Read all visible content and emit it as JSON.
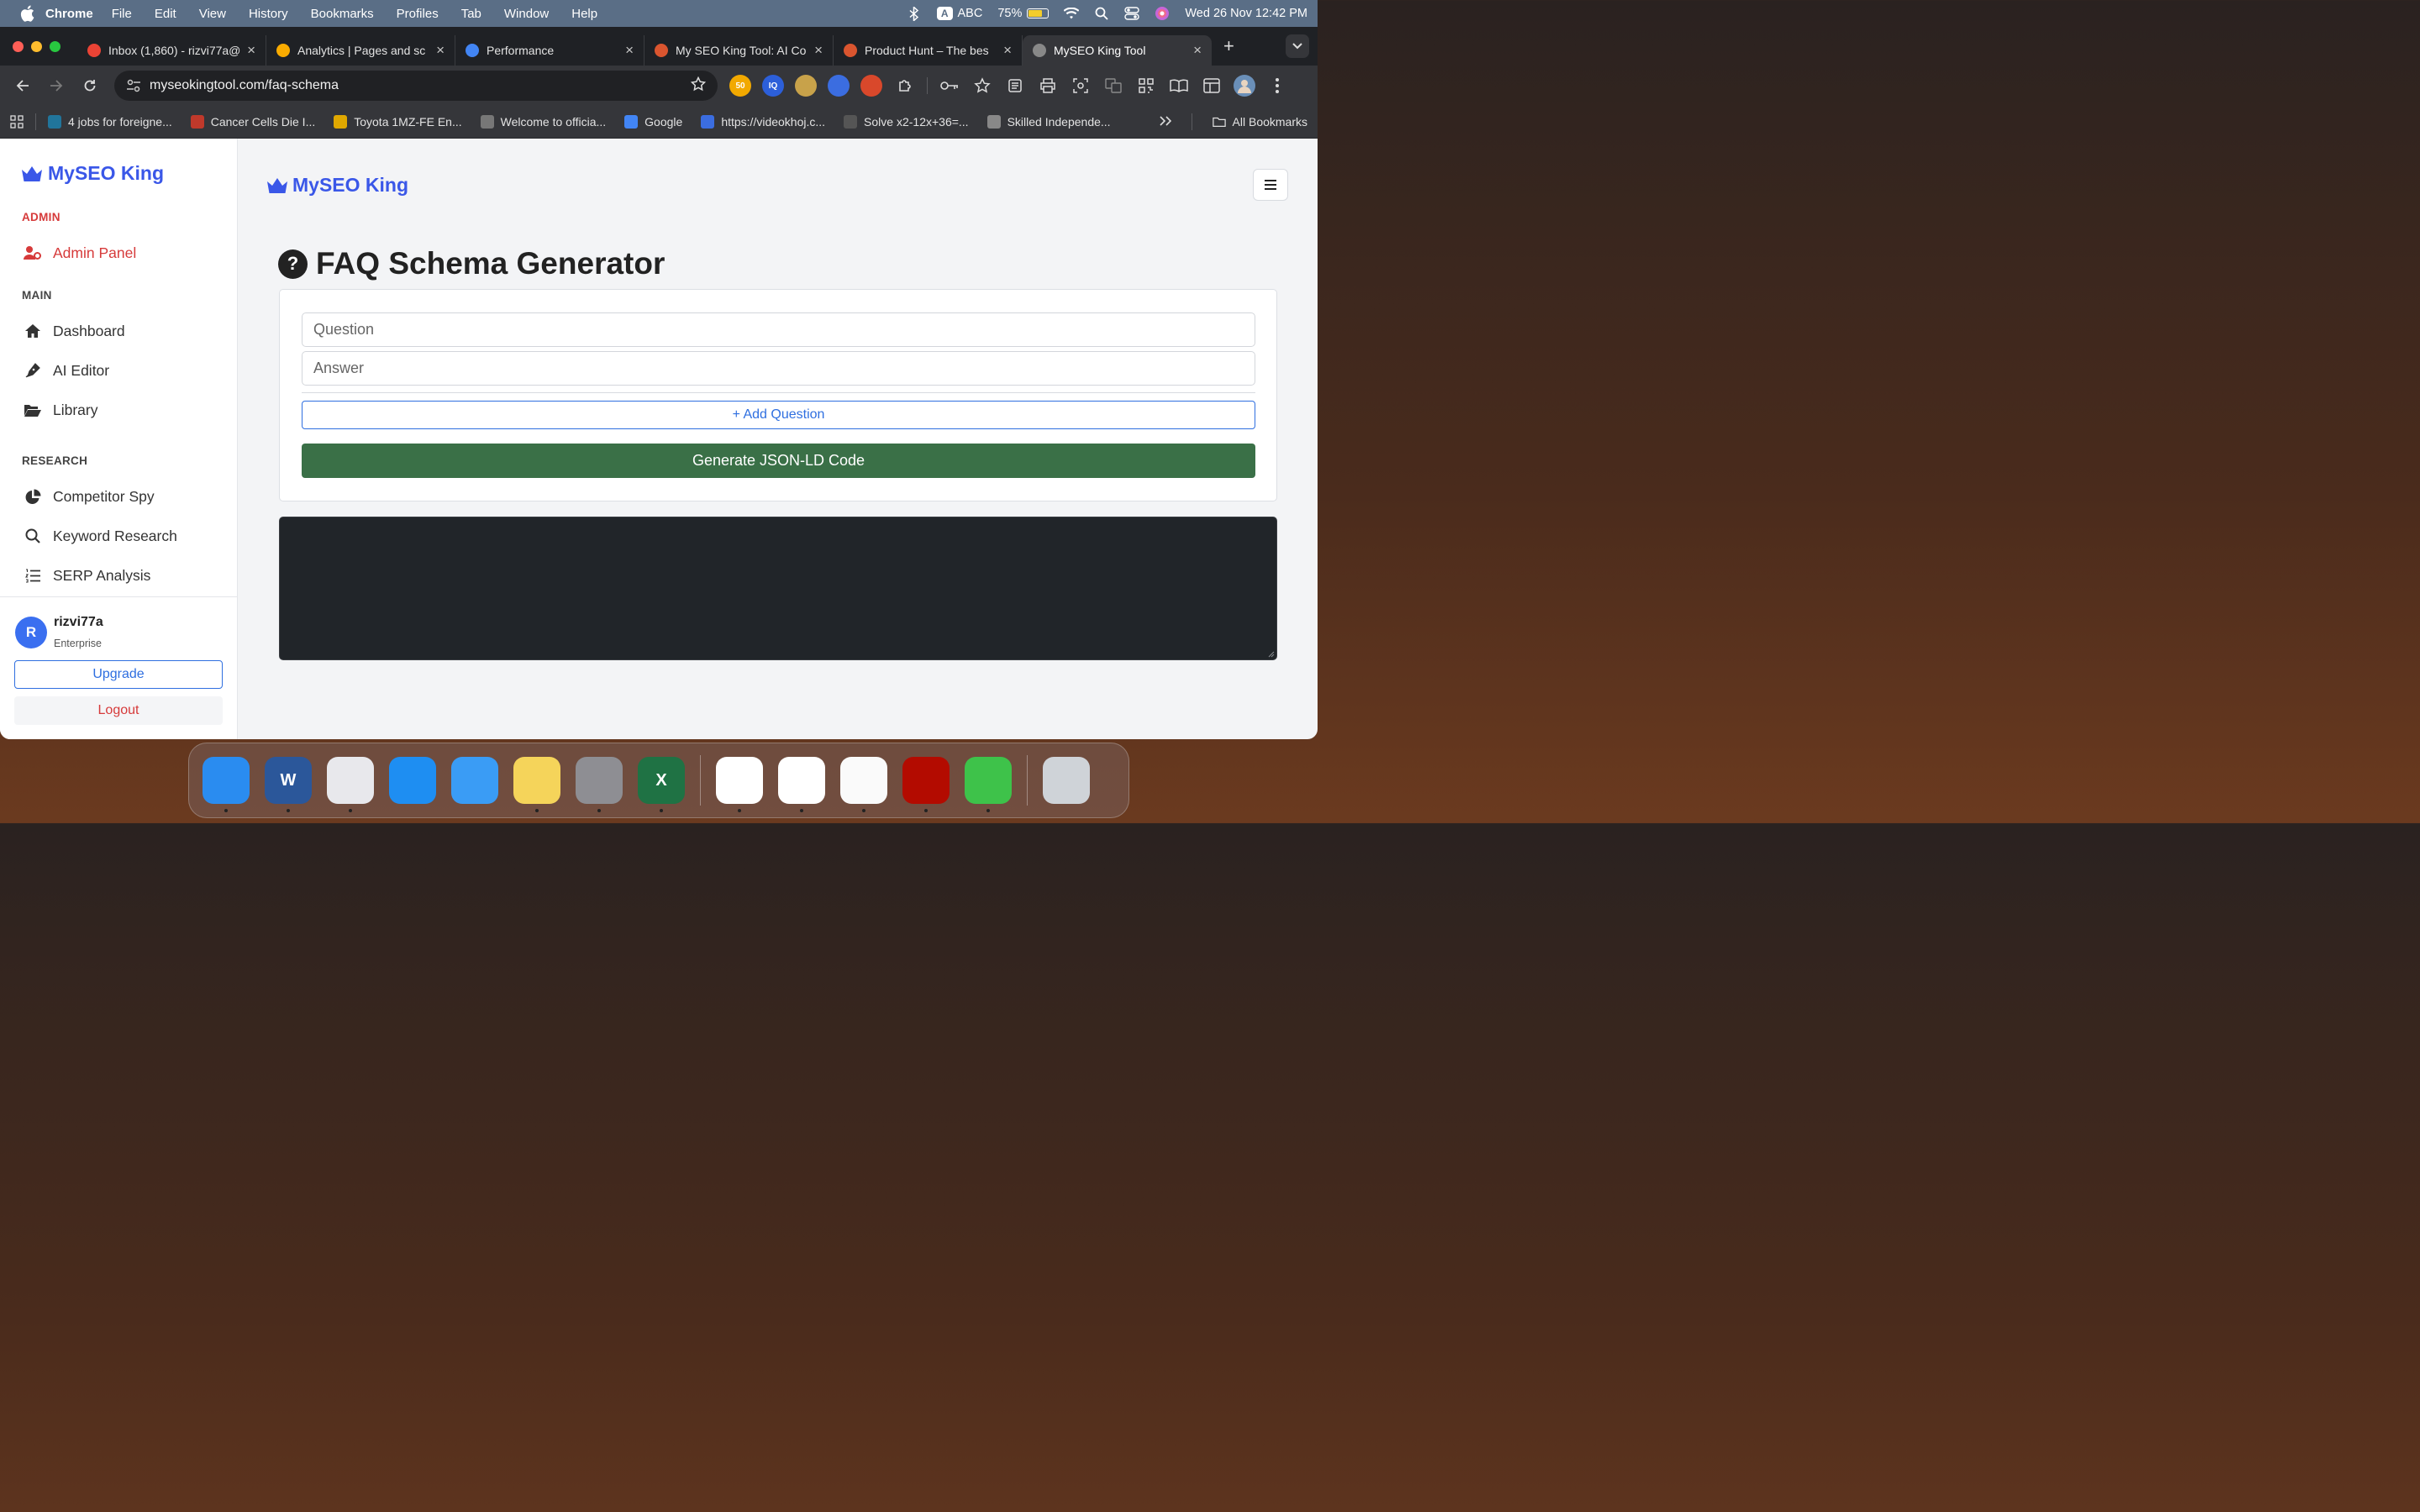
{
  "menubar": {
    "app": "Chrome",
    "items": [
      "File",
      "Edit",
      "View",
      "History",
      "Bookmarks",
      "Profiles",
      "Tab",
      "Window",
      "Help"
    ],
    "input_source": "A",
    "input_label": "ABC",
    "battery": "75%",
    "battery_level": 0.75,
    "datetime": "Wed 26 Nov  12:42 PM"
  },
  "tabs": [
    {
      "title": "Inbox (1,860) - rizvi77a@",
      "icon": "gmail-icon",
      "color": "#ea4335"
    },
    {
      "title": "Analytics | Pages and sc",
      "icon": "analytics-icon",
      "color": "#f9ab00"
    },
    {
      "title": "Performance",
      "icon": "search-console-icon",
      "color": "#4285f4"
    },
    {
      "title": "My SEO King Tool: AI Co",
      "icon": "product-hunt-icon",
      "color": "#da552f"
    },
    {
      "title": "Product Hunt – The bes",
      "icon": "product-hunt-icon",
      "color": "#da552f"
    },
    {
      "title": "MySEO King Tool",
      "icon": "globe-icon",
      "color": "#888888"
    }
  ],
  "address_bar": {
    "url": "myseokingtool.com/faq-schema"
  },
  "extensions": [
    {
      "label": "50",
      "color": "#f2a900"
    },
    {
      "label": "IQ",
      "color": "#2c5fd9"
    },
    {
      "label": "",
      "color": "#c8a24a"
    },
    {
      "label": "",
      "color": "#3b6de0"
    },
    {
      "label": "",
      "color": "#d9482b"
    }
  ],
  "bookmarks": [
    {
      "label": "4 jobs for foreigne...",
      "icon": "wordpress-icon",
      "color": "#21759b"
    },
    {
      "label": "Cancer Cells Die I...",
      "icon": "news-icon",
      "color": "#c0392b"
    },
    {
      "label": "Toyota 1MZ-FE En...",
      "icon": "engine-icon",
      "color": "#e0a800"
    },
    {
      "label": "Welcome to officia...",
      "icon": "seal-icon",
      "color": "#777777"
    },
    {
      "label": "Google",
      "icon": "google-icon",
      "color": "#4285f4"
    },
    {
      "label": "https://videokhoj.c...",
      "icon": "check-icon",
      "color": "#3b6de0"
    },
    {
      "label": "Solve x2-12x+36=...",
      "icon": "math-icon",
      "color": "#555555"
    },
    {
      "label": "Skilled Independe...",
      "icon": "globe-icon",
      "color": "#888888"
    }
  ],
  "all_bookmarks": "All Bookmarks",
  "brand": {
    "name": "MySEO King",
    "color": "#3a57e8"
  },
  "sidebar": {
    "sections": {
      "admin": "ADMIN",
      "main": "MAIN",
      "research": "RESEARCH"
    },
    "items": {
      "admin_panel": "Admin Panel",
      "dashboard": "Dashboard",
      "ai_editor": "AI Editor",
      "library": "Library",
      "competitor_spy": "Competitor Spy",
      "keyword_research": "Keyword Research",
      "serp_analysis": "SERP Analysis"
    },
    "user": {
      "initial": "R",
      "name": "rizvi77a",
      "plan": "Enterprise",
      "upgrade": "Upgrade",
      "logout": "Logout"
    }
  },
  "main": {
    "title": "FAQ Schema Generator",
    "question_placeholder": "Question",
    "answer_placeholder": "Answer",
    "add_question": "+ Add Question",
    "generate": "Generate JSON-LD Code"
  },
  "dock": [
    {
      "name": "finder-icon",
      "label": "",
      "color": "#2a8cf0"
    },
    {
      "name": "word-icon",
      "label": "W",
      "color": "#2b579a"
    },
    {
      "name": "launchpad-icon",
      "label": "",
      "color": "#e8e8ec"
    },
    {
      "name": "safari-icon",
      "label": "",
      "color": "#1e8ef2"
    },
    {
      "name": "mail-icon",
      "label": "",
      "color": "#3a9cf5"
    },
    {
      "name": "notes-icon",
      "label": "",
      "color": "#f5d45a"
    },
    {
      "name": "settings-icon",
      "label": "",
      "color": "#8e8e93"
    },
    {
      "name": "excel-icon",
      "label": "X",
      "color": "#1f7244"
    },
    {
      "name": "chrome-icon",
      "label": "",
      "color": "#ffffff"
    },
    {
      "name": "vscode-icon",
      "label": "",
      "color": "#ffffff"
    },
    {
      "name": "textedit-icon",
      "label": "",
      "color": "#fafafa"
    },
    {
      "name": "acrobat-icon",
      "label": "",
      "color": "#b30b00"
    },
    {
      "name": "numbers-icon",
      "label": "",
      "color": "#3ec24a"
    },
    {
      "name": "trash-icon",
      "label": "",
      "color": "#cfd3d8"
    }
  ]
}
